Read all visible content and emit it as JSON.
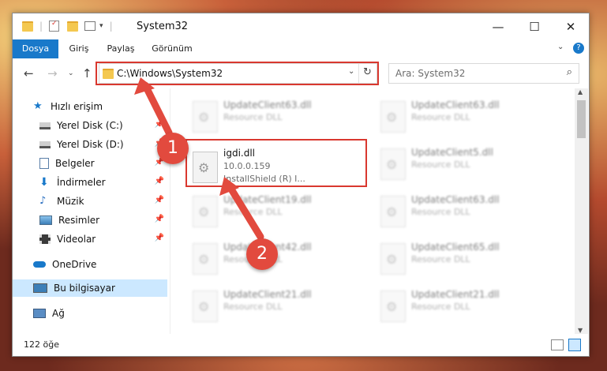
{
  "window": {
    "title": "System32",
    "controls": {
      "minimize": "—",
      "maximize": "☐",
      "close": "✕"
    }
  },
  "ribbon": {
    "tabs": [
      {
        "label": "Dosya",
        "active": true
      },
      {
        "label": "Giriş"
      },
      {
        "label": "Paylaş"
      },
      {
        "label": "Görünüm"
      }
    ],
    "help_glyph": "?"
  },
  "address": {
    "path": "C:\\Windows\\System32"
  },
  "search": {
    "placeholder": "Ara: System32"
  },
  "sidebar": {
    "items": [
      {
        "label": "Hızlı erişim",
        "icon": "star-icon"
      },
      {
        "label": "Yerel Disk (C:)",
        "icon": "drive-icon",
        "pinned": true
      },
      {
        "label": "Yerel Disk (D:)",
        "icon": "drive-icon",
        "pinned": true
      },
      {
        "label": "Belgeler",
        "icon": "documents-icon",
        "pinned": true
      },
      {
        "label": "İndirmeler",
        "icon": "download-icon",
        "pinned": true
      },
      {
        "label": "Müzik",
        "icon": "music-icon",
        "pinned": true
      },
      {
        "label": "Resimler",
        "icon": "pictures-icon",
        "pinned": true
      },
      {
        "label": "Videolar",
        "icon": "videos-icon",
        "pinned": true
      },
      {
        "label": "OneDrive",
        "icon": "cloud-icon"
      },
      {
        "label": "Bu bilgisayar",
        "icon": "computer-icon",
        "selected": true
      },
      {
        "label": "Ağ",
        "icon": "network-icon"
      }
    ]
  },
  "files": {
    "left": [
      {
        "name": "UpdateClient63.dll",
        "type": "Resource DLL"
      },
      {
        "name": "UpdateClient19.dll",
        "type": "Resource DLL"
      },
      {
        "name": "UpdateClient42.dll",
        "type": "Resource DLL"
      },
      {
        "name": "UpdateClient21.dll",
        "type": "Resource DLL"
      }
    ],
    "right": [
      {
        "name": "UpdateClient63.dll",
        "type": "Resource DLL"
      },
      {
        "name": "UpdateClient5.dll",
        "type": "Resource DLL"
      },
      {
        "name": "UpdateClient63.dll",
        "type": "Resource DLL"
      },
      {
        "name": "UpdateClient65.dll",
        "type": "Resource DLL"
      },
      {
        "name": "UpdateClient21.dll",
        "type": "Resource DLL"
      }
    ],
    "highlighted": {
      "name": "igdi.dll",
      "version": "10.0.0.159",
      "company": "InstallShield (R) I..."
    }
  },
  "status": {
    "count": "122 öğe"
  },
  "annotations": {
    "badge1": "1",
    "badge2": "2",
    "accent": "#e24a3e"
  }
}
